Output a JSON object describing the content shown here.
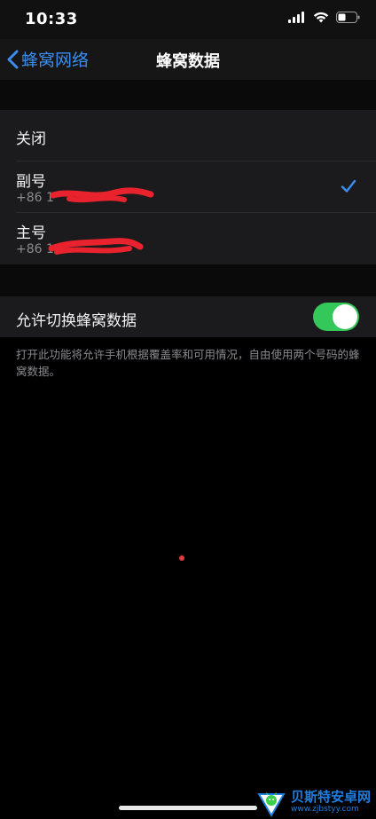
{
  "status_bar": {
    "time": "10:33",
    "icons": [
      "signal-icon",
      "wifi-icon",
      "battery-icon"
    ]
  },
  "nav": {
    "back_label": "蜂窝网络",
    "title": "蜂窝数据"
  },
  "options": {
    "off_label": "关闭",
    "secondary": {
      "label": "副号",
      "number": "+86 1",
      "selected": true
    },
    "primary": {
      "label": "主号",
      "number": "+86 1"
    }
  },
  "switching": {
    "label": "允许切换蜂窝数据",
    "enabled": true,
    "footnote": "打开此功能将允许手机根据覆盖率和可用情况，自由使用两个号码的蜂窝数据。"
  },
  "watermark": {
    "name": "贝斯特安卓网",
    "url": "www.zjbstyy.com"
  },
  "colors": {
    "accent": "#3b8ef0",
    "toggle_on": "#34c759",
    "redaction": "#e8232d"
  }
}
